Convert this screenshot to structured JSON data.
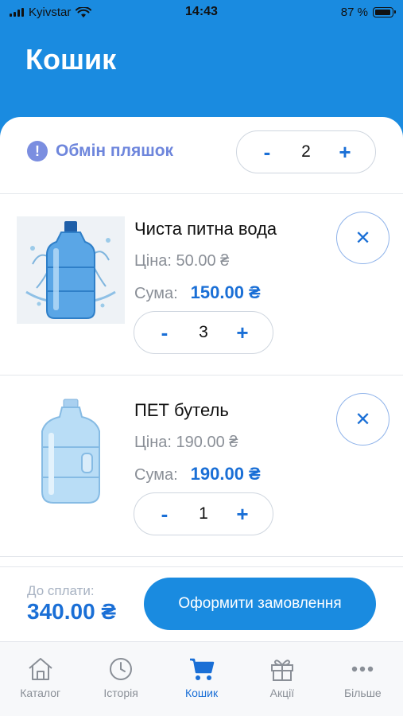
{
  "status_bar": {
    "carrier": "Kyivstar",
    "time": "14:43",
    "battery": "87 %"
  },
  "header": {
    "title": "Кошик"
  },
  "exchange": {
    "label": "Обмін пляшок",
    "minus": "-",
    "plus": "+",
    "quantity": "2"
  },
  "items": [
    {
      "name": "Чиста питна вода",
      "price": "Ціна: 50.00 ₴",
      "sum_label": "Сума:",
      "sum": "150.00 ₴",
      "minus": "-",
      "plus": "+",
      "quantity": "3",
      "remove": "✕"
    },
    {
      "name": "ПЕТ бутель",
      "price": "Ціна: 190.00 ₴",
      "sum_label": "Сума:",
      "sum": "190.00 ₴",
      "minus": "-",
      "plus": "+",
      "quantity": "1",
      "remove": "✕"
    }
  ],
  "footer": {
    "to_pay_label": "До сплати:",
    "to_pay": "340.00 ₴",
    "checkout": "Оформити замовлення"
  },
  "tabs": [
    {
      "label": "Каталог",
      "icon": "home-icon"
    },
    {
      "label": "Історія",
      "icon": "clock-icon"
    },
    {
      "label": "Кошик",
      "icon": "cart-icon",
      "active": true
    },
    {
      "label": "Акції",
      "icon": "gift-icon"
    },
    {
      "label": "Більше",
      "icon": "more-icon"
    }
  ],
  "colors": {
    "brand": "#1a8be0",
    "accent": "#1a6fd6",
    "exchange_text": "#6e86dc"
  }
}
